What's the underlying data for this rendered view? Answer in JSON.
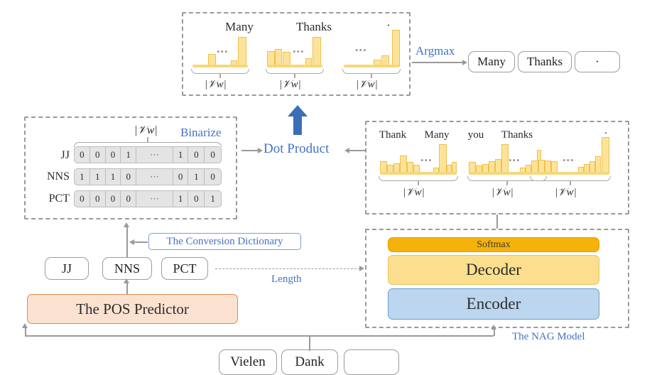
{
  "figure": {
    "title": "NAG model with POS Predictor architecture diagram",
    "colors": {
      "accent_blue": "#4472c4",
      "bar_fill": "#fde39a",
      "bar_stroke": "#efc04c",
      "softmax": "#f5b20a",
      "decoder": "#fbdf8e",
      "encoder": "#bcd6ef",
      "pos_predictor_fill": "#fbe2d0",
      "pos_predictor_stroke": "#e08a4f",
      "matrix_fill": "#e4e4e4",
      "dash_border": "#9a9a9a"
    },
    "vocab_symbol": "|𝒱w|"
  },
  "output_panel": {
    "name": "argmax-distribution-panel",
    "distributions": [
      {
        "peak_label": "Many",
        "bars": [
          0,
          0,
          0,
          38,
          0,
          0,
          0,
          0,
          0,
          0,
          22,
          100,
          0
        ],
        "dots_after": 4
      },
      {
        "peak_label": "Thanks",
        "bars": [
          52,
          60,
          50,
          0,
          0,
          0,
          0,
          0,
          0,
          30,
          100,
          0,
          0
        ],
        "dots_after": 4
      },
      {
        "peak_label": "·",
        "bars": [
          0,
          0,
          0,
          0,
          0,
          0,
          0,
          22,
          36,
          0,
          0,
          100,
          0
        ],
        "dots_after": 3
      }
    ],
    "axis_labels": [
      "|𝒱w|",
      "|𝒱w|",
      "|𝒱w|"
    ]
  },
  "argmax": {
    "label": "Argmax",
    "tokens": [
      "Many",
      "Thanks",
      "·"
    ]
  },
  "binarize_panel": {
    "vocab_label": "|𝒱w|",
    "binarize_label": "Binarize",
    "row_labels": [
      "JJ",
      "NNS",
      "PCT"
    ],
    "rows": [
      [
        "0",
        "0",
        "0",
        "1",
        "⋯",
        "1",
        "0",
        "0"
      ],
      [
        "1",
        "1",
        "1",
        "0",
        "⋯",
        "0",
        "1",
        "0"
      ],
      [
        "0",
        "0",
        "0",
        "0",
        "⋯",
        "1",
        "0",
        "1"
      ]
    ]
  },
  "dot_product": {
    "label": "Dot Product"
  },
  "softmax_panel": {
    "name": "decoder-output-distributions",
    "word_labels": [
      "Thank",
      "Many",
      "you",
      "Thanks",
      "·"
    ],
    "distributions": [
      {
        "bars": [
          42,
          30,
          36,
          62,
          40,
          30,
          0,
          0,
          0,
          20,
          100,
          30,
          26,
          40
        ],
        "dots_after": 6
      },
      {
        "bars": [
          40,
          28,
          34,
          42,
          50,
          100,
          0,
          0,
          0,
          20,
          30,
          36,
          80,
          42
        ],
        "dots_after": 6
      },
      {
        "bars": [
          36,
          38,
          36,
          34,
          0,
          0,
          0,
          0,
          18,
          26,
          34,
          40,
          48,
          100
        ],
        "dots_after": 4
      }
    ],
    "axis_labels": [
      "|𝒱w|",
      "|𝒱w|",
      "|𝒱w|"
    ]
  },
  "pos_stage": {
    "predictor_label": "The POS Predictor",
    "tags": [
      "JJ",
      "NNS",
      "PCT"
    ],
    "conversion_dictionary_label": "The Conversion Dictionary",
    "length_label": "Length"
  },
  "nag_model": {
    "caption": "The NAG Model",
    "layers": [
      {
        "label": "Softmax",
        "color": "#f5b20a"
      },
      {
        "label": "Decoder",
        "color": "#fbdf8e"
      },
      {
        "label": "Encoder",
        "color": "#bcd6ef"
      }
    ]
  },
  "source_input": {
    "tokens": [
      "Vielen",
      "Dank",
      ""
    ]
  }
}
